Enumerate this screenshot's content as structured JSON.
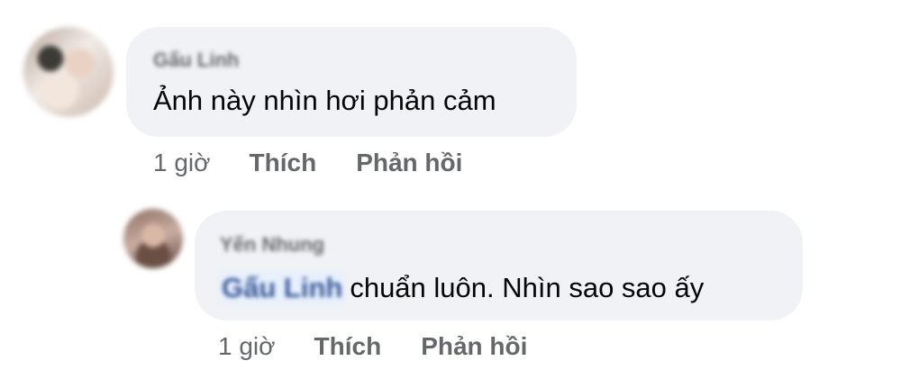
{
  "comments": [
    {
      "author": "Gấu Linh",
      "text": "Ảnh này nhìn hơi phản cảm",
      "time": "1 giờ",
      "like_label": "Thích",
      "reply_label": "Phản hồi"
    },
    {
      "author": "Yến Nhung",
      "mention": "Gấu Linh",
      "text": "chuẩn luôn. Nhìn sao sao ấy",
      "time": "1 giờ",
      "like_label": "Thích",
      "reply_label": "Phản hồi"
    }
  ]
}
